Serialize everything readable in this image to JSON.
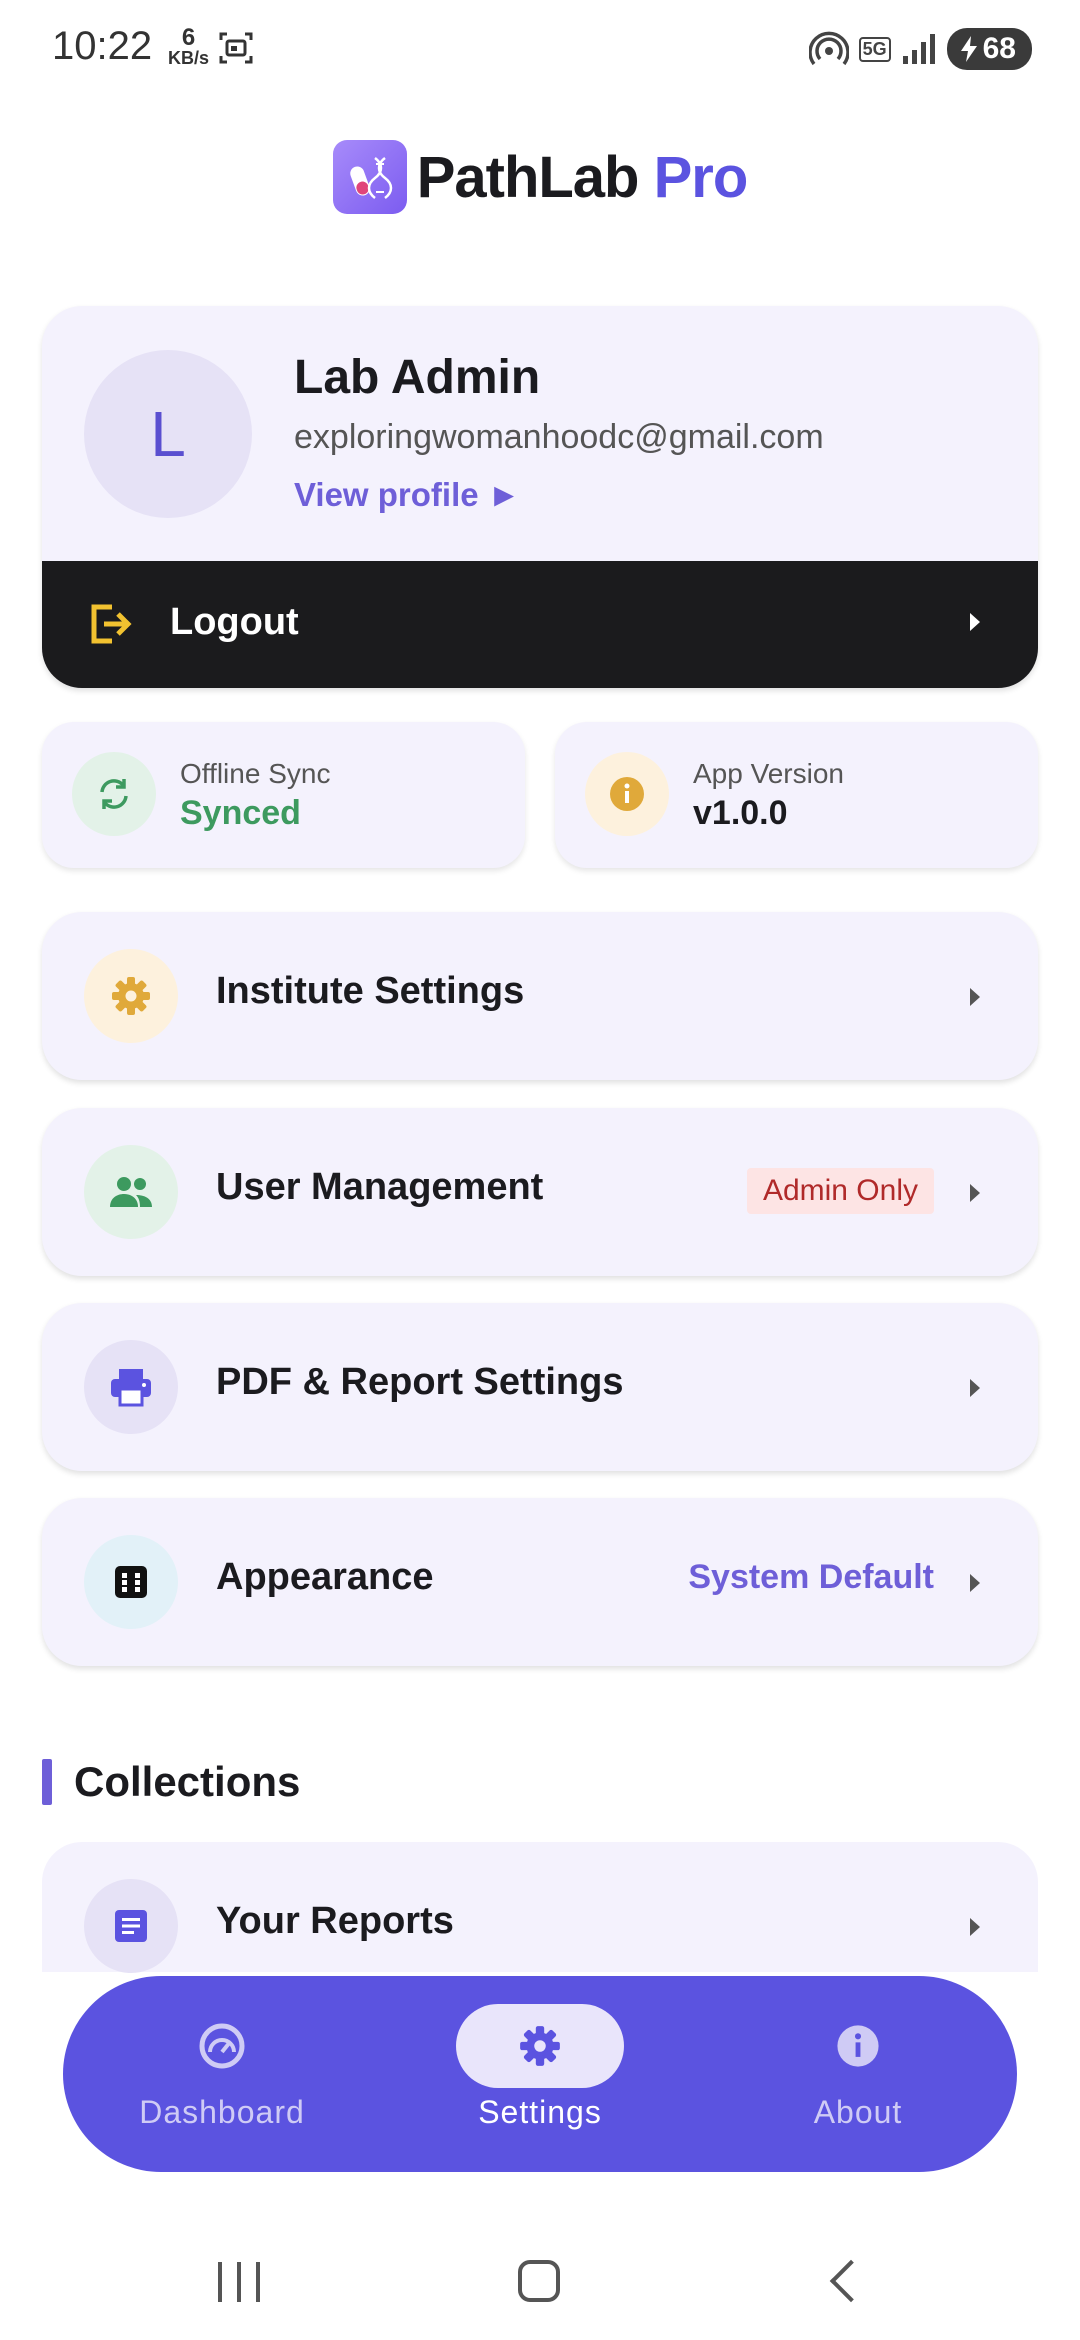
{
  "status_bar": {
    "time": "10:22",
    "net_speed_value": "6",
    "net_speed_unit": "KB/s",
    "network": "5G",
    "battery": "68"
  },
  "header": {
    "app_name_main": "PathLab",
    "app_name_accent": "Pro"
  },
  "profile": {
    "avatar_initial": "L",
    "name": "Lab Admin",
    "email": "exploringwomanhoodc@gmail.com",
    "view_profile_label": "View profile ►"
  },
  "logout": {
    "label": "Logout"
  },
  "info_cards": {
    "sync": {
      "label": "Offline Sync",
      "value": "Synced",
      "color": "#3d9a5f"
    },
    "version": {
      "label": "App Version",
      "value": "v1.0.0",
      "color": "#1b1b1f"
    }
  },
  "menu": {
    "institute_settings": {
      "label": "Institute Settings"
    },
    "user_management": {
      "label": "User Management",
      "badge": "Admin Only"
    },
    "pdf_report_settings": {
      "label": "PDF & Report Settings"
    },
    "appearance": {
      "label": "Appearance",
      "value": "System Default"
    }
  },
  "collections": {
    "title": "Collections",
    "items": [
      {
        "label": "Your Reports"
      }
    ]
  },
  "bottom_nav": {
    "tabs": [
      {
        "label": "Dashboard",
        "icon": "dashboard-icon"
      },
      {
        "label": "Settings",
        "icon": "gear-icon",
        "active": true
      },
      {
        "label": "About",
        "icon": "info-icon"
      }
    ]
  },
  "colors": {
    "accent": "#5b53e0",
    "card_bg": "#f4f2fd",
    "logout_bg": "#1b1b1d"
  }
}
